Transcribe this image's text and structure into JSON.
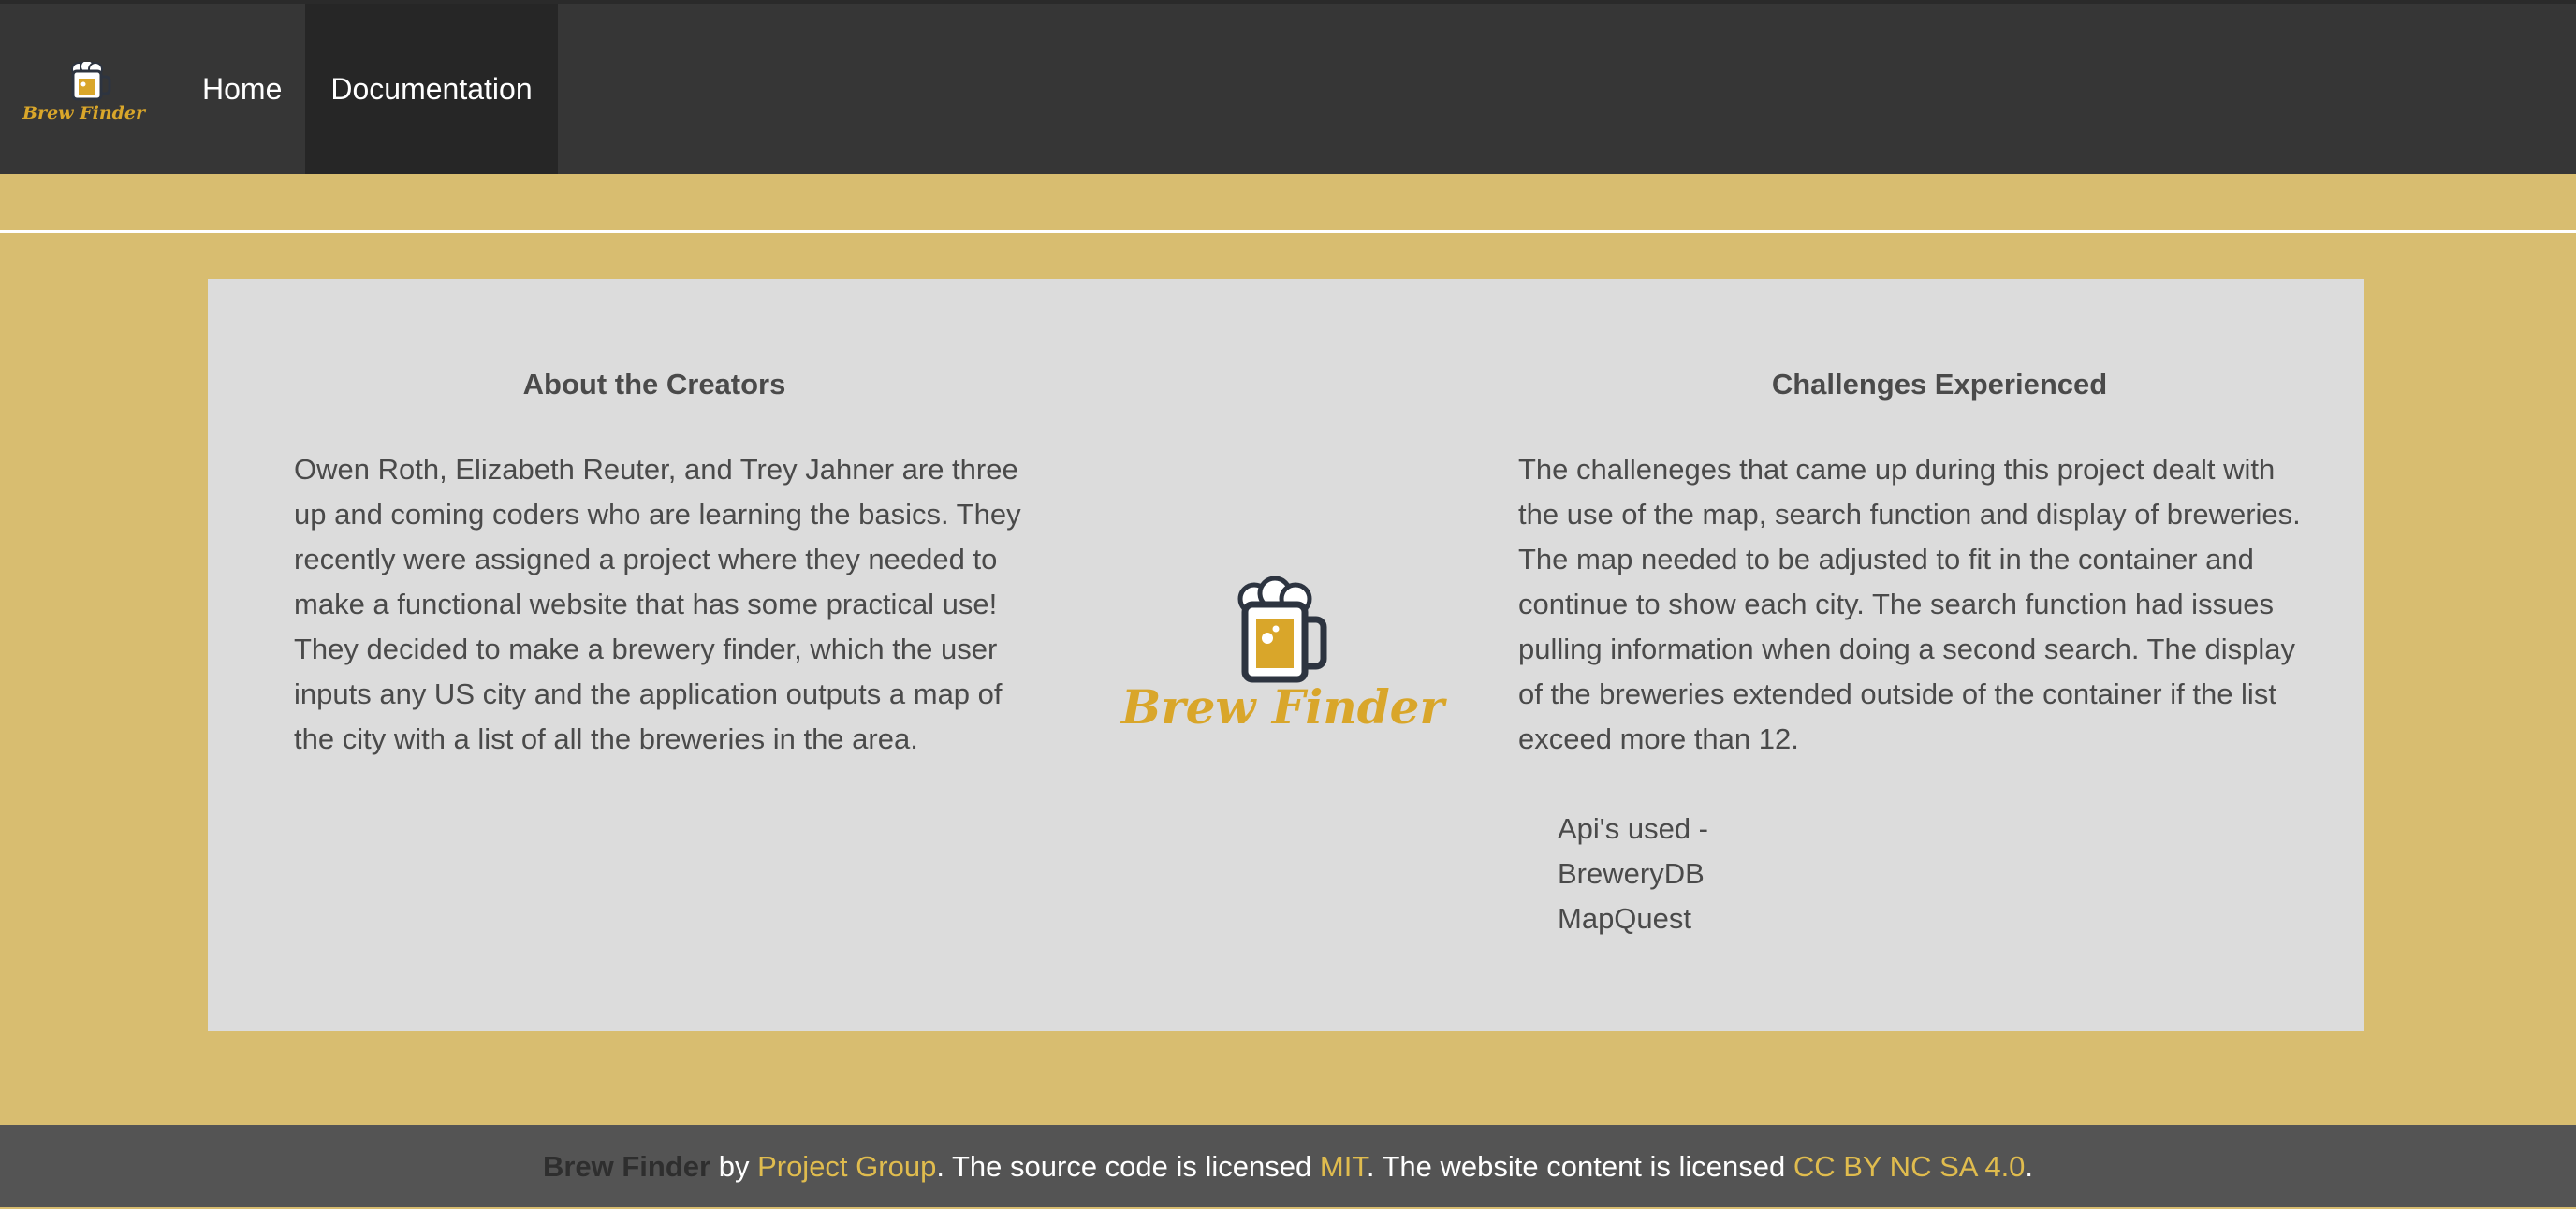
{
  "colors": {
    "nav_bg": "#363636",
    "nav_active_bg": "#262626",
    "page_bg": "#d8bd70",
    "card_bg": "#dcdcdc",
    "footer_bg": "#545454",
    "brand_gold": "#d9a62a",
    "link_gold": "#e0bc4e",
    "text_gray": "#4a4a4a"
  },
  "logo": {
    "icon": "beer-mug-icon",
    "text": "Brew Finder"
  },
  "nav": {
    "items": [
      {
        "label": "Home",
        "active": false
      },
      {
        "label": "Documentation",
        "active": true
      }
    ]
  },
  "about": {
    "title": "About the Creators",
    "text": "Owen Roth, Elizabeth Reuter, and Trey Jahner are three up and coming coders who are learning the basics. They recently were assigned a project where they needed to make a functional website that has some practical use! They decided to make a brewery finder, which the user inputs any US city and the application outputs a map of the city with a list of all the breweries in the area."
  },
  "challenges": {
    "title": "Challenges Experienced",
    "text": "The challeneges that came up during this project dealt with the use of the map, search function and display of breweries. The map needed to be adjusted to fit in the container and continue to show each city. The search function had issues pulling information when doing a second search. The display of the breweries extended outside of the container if the list exceed more than 12.",
    "apis_heading": "Api's used -",
    "apis": [
      "BreweryDB",
      "MapQuest"
    ]
  },
  "footer": {
    "brand": "Brew Finder",
    "by": " by ",
    "group_link": "Project Group",
    "source_text": ". The source code is licensed ",
    "mit_link": "MIT",
    "content_text": ". The website content is licensed ",
    "cc_link": "CC BY NC SA 4.0",
    "end": "."
  }
}
